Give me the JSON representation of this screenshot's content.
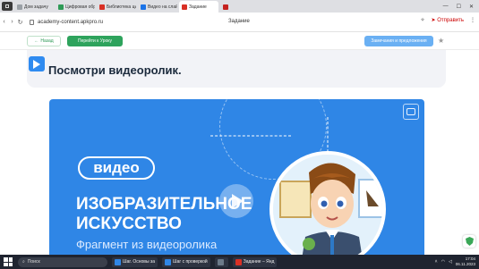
{
  "browser": {
    "tabs": [
      {
        "title": "Дом задачу",
        "color": "#9aa0a6",
        "active": false
      },
      {
        "title": "Цифровая образова",
        "color": "#2e9a56",
        "active": false
      },
      {
        "title": "Библиотека цифров",
        "color": "#d93025",
        "active": false
      },
      {
        "title": "Видео на слайды",
        "color": "#1a73e8",
        "active": false
      },
      {
        "title": "Задание",
        "color": "#d93025",
        "active": true
      },
      {
        "title": "",
        "color": "#c5221f",
        "active": false
      }
    ],
    "url": "academy-content.apkpro.ru",
    "page_title": "Задание",
    "share_label": "Отправить"
  },
  "site": {
    "back_label": "Назад",
    "lesson_label": "Перейти к Уроку",
    "feedback_label": "Замечания и предложения"
  },
  "task": {
    "text": "Посмотри видеоролик."
  },
  "video": {
    "badge": "видео",
    "title_line1": "ИЗОБРАЗИТЕЛЬНОЕ",
    "title_line2": "ИСКУССТВО",
    "subtitle": "Фрагмент из видеоролика"
  },
  "taskbar": {
    "search_label": "Поиск",
    "apps": [
      {
        "label": "Шаг. Основы за",
        "color": "#2f86e6"
      },
      {
        "label": "Шаг с проверкой",
        "color": "#2f86e6"
      },
      {
        "label": "",
        "color": "#6c7a89"
      },
      {
        "label": "Задание – Янд",
        "color": "#d93025"
      }
    ],
    "time": "17:04",
    "date": "06.11.2023"
  }
}
